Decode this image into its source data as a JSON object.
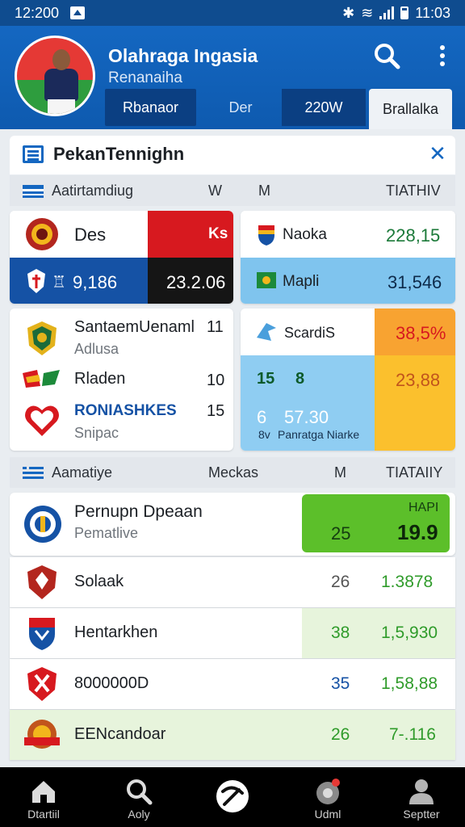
{
  "status_bar": {
    "time_left": "12:200",
    "time_right": "11:03"
  },
  "header": {
    "title": "Olahraga Ingasia",
    "subtitle": "Renanaiha",
    "tabs": [
      "Rbanaor",
      "Der",
      "220W",
      "Brallalka"
    ]
  },
  "panel": {
    "title": "PekanTennighn"
  },
  "section1": {
    "label": "Aatirtamdiug",
    "col1": "W",
    "col2": "M",
    "col3": "TIATHIV"
  },
  "card_a": {
    "team": "Des",
    "badge": "Ks",
    "score_label": "9,186",
    "score_value": "23.2.06"
  },
  "card_b": {
    "row1_label": "Naoka",
    "row1_value": "228,15",
    "row2_label": "Mapli",
    "row2_value": "31,546"
  },
  "card_c": {
    "row1_name": "SantaemUenaml",
    "row1_num": "11",
    "row1_sub": "Adlusa",
    "row2_name": "Rladen",
    "row2_num": "10",
    "row3_name": "RONIASHKES",
    "row3_num": "15",
    "row3_sub": "Snipac"
  },
  "card_d": {
    "title": "ScardiS",
    "val1": "38,5%",
    "row_a": "15",
    "row_b": "8",
    "val2": "23,88",
    "row_c": "6",
    "row_d": "57.30",
    "foot_a": "8v",
    "foot_b": "Panratga Niarke"
  },
  "section2": {
    "label": "Aamatiye",
    "col1": "Meckas",
    "col2": "M",
    "col3": "TIATAIIY"
  },
  "featured": {
    "name": "Pernupn Dpeaan",
    "sub": "Pematlive",
    "tag": "HAPI",
    "num": "25",
    "value": "19.9"
  },
  "list_rows": [
    {
      "name": "Solaak",
      "num": "26",
      "value": "1.3878"
    },
    {
      "name": "Hentarkhen",
      "num": "38",
      "value": "1,5,930"
    },
    {
      "name": "8000000D",
      "num": "35",
      "value": "1,58,88"
    },
    {
      "name": "EENcandoar",
      "num": "26",
      "value": "7-.116"
    }
  ],
  "bottom_nav": [
    "Dtartiil",
    "Aoly",
    "",
    "Udml",
    "Septter"
  ],
  "colors": {
    "brand": "#1467c1",
    "green": "#5cbf2a",
    "red": "#d7191f",
    "light_blue": "#7fc4ee",
    "orange": "#fbb32d"
  }
}
